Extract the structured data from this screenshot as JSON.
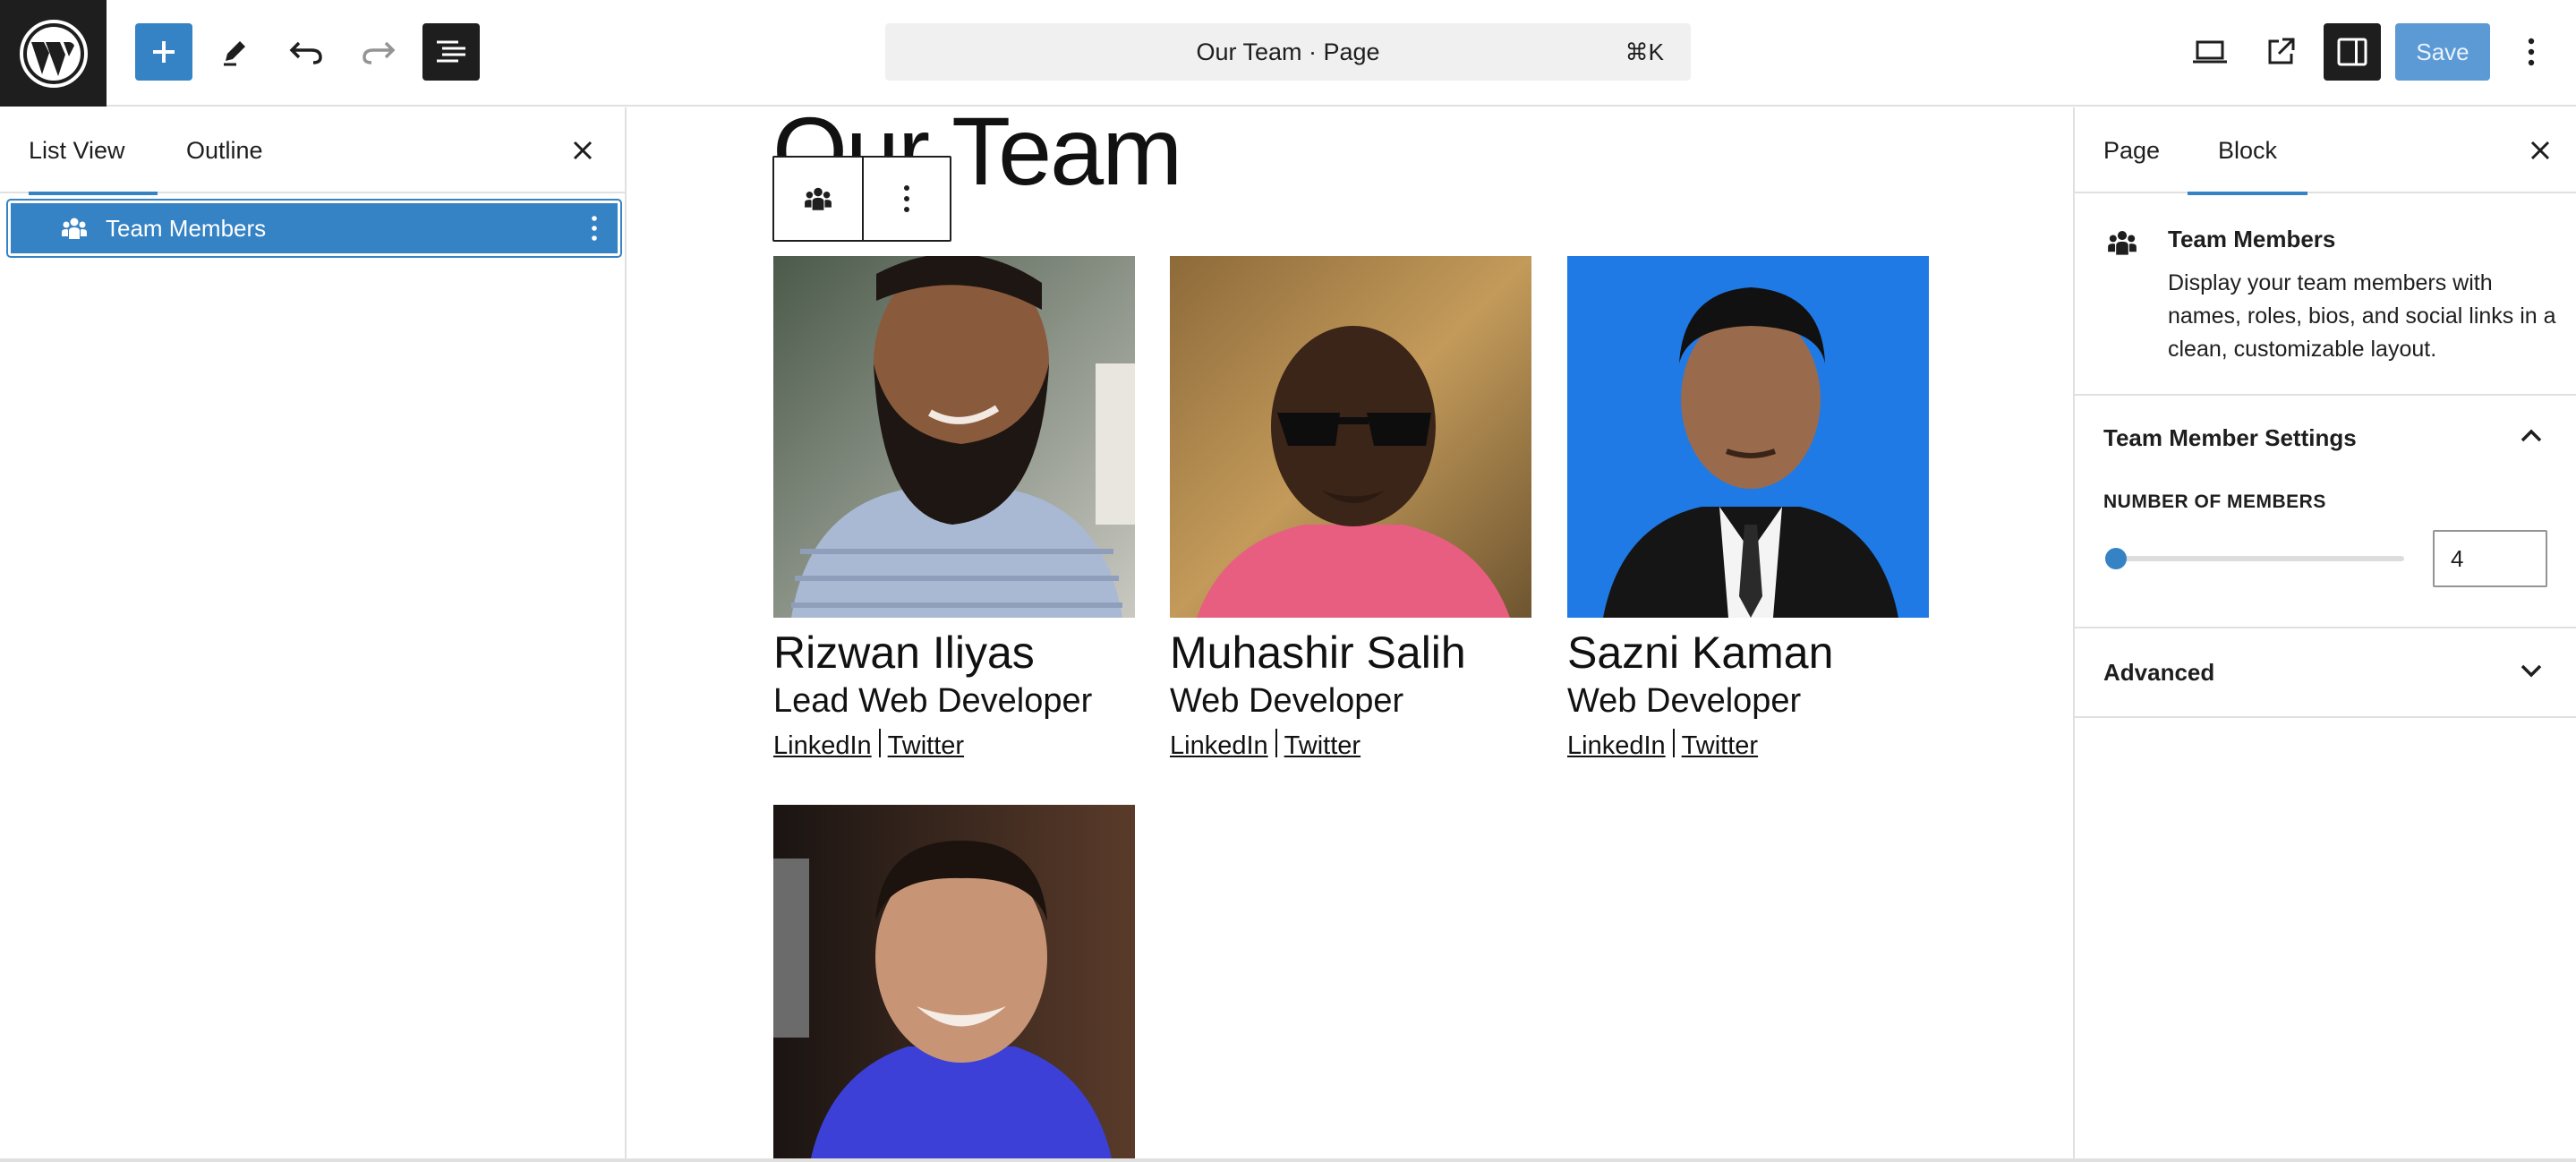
{
  "header": {
    "command_bar_title": "Our Team · Page",
    "command_shortcut": "⌘K",
    "save_label": "Save",
    "icons": [
      "wordpress-logo",
      "plus-icon",
      "pencil-icon",
      "undo-icon",
      "redo-icon",
      "document-overview-icon",
      "desktop-preview-icon",
      "external-view-icon",
      "sidebar-toggle-icon",
      "more-vertical-icon"
    ]
  },
  "left_sidebar": {
    "tabs": [
      "List View",
      "Outline"
    ],
    "active_tab": "List View",
    "items": [
      {
        "label": "Team Members",
        "icon": "team-icon"
      }
    ]
  },
  "canvas": {
    "page_title": "Our Team",
    "members": [
      {
        "name": "Rizwan Iliyas",
        "role": "Lead Web Developer",
        "link1": "LinkedIn",
        "link2": "Twitter"
      },
      {
        "name": "Muhashir Salih",
        "role": "Web Developer",
        "link1": "LinkedIn",
        "link2": "Twitter"
      },
      {
        "name": "Sazni Kaman",
        "role": "Web Developer",
        "link1": "LinkedIn",
        "link2": "Twitter"
      },
      {
        "name": "",
        "role": "",
        "link1": "",
        "link2": ""
      }
    ]
  },
  "right_sidebar": {
    "tabs": [
      "Page",
      "Block"
    ],
    "active_tab": "Block",
    "block": {
      "title": "Team Members",
      "description": "Display your team members with names, roles, bios, and social links in a clean, customizable layout."
    },
    "settings": {
      "title": "Team Member Settings",
      "range_label": "NUMBER OF MEMBERS",
      "range_value": "4",
      "range_fraction": 0.0
    },
    "advanced_title": "Advanced"
  },
  "colors": {
    "accent": "#3582c4",
    "dark": "#1e1e1e",
    "save_disabled": "#5c9ad6"
  }
}
